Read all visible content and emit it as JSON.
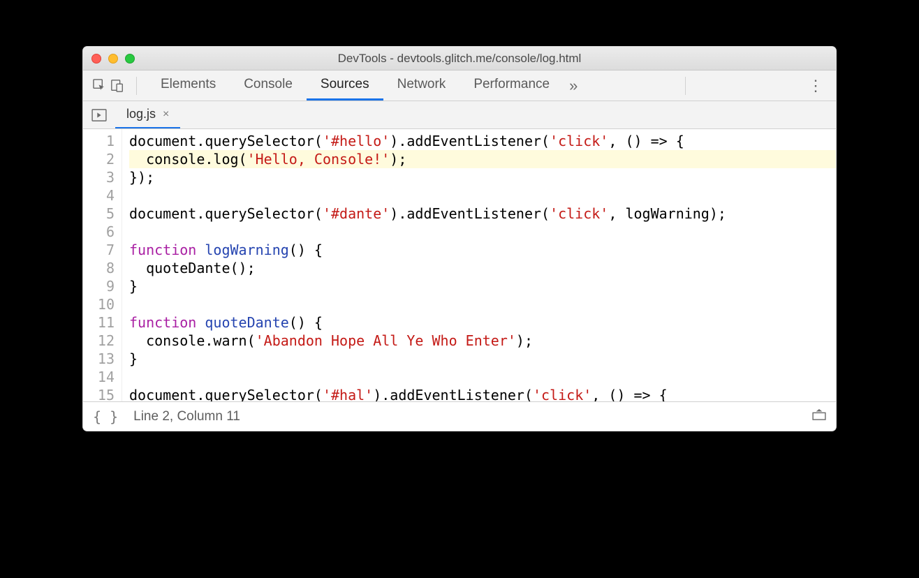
{
  "window": {
    "title": "DevTools - devtools.glitch.me/console/log.html"
  },
  "panels": {
    "elements": "Elements",
    "console": "Console",
    "sources": "Sources",
    "network": "Network",
    "performance": "Performance",
    "more": "»"
  },
  "fileTab": {
    "name": "log.js",
    "close": "×"
  },
  "status": {
    "braces": "{ }",
    "position": "Line 2, Column 11"
  },
  "code": {
    "lines": [
      {
        "n": "1",
        "hl": false,
        "tokens": [
          [
            "p",
            "document.querySelector("
          ],
          [
            "s",
            "'#hello'"
          ],
          [
            "p",
            ").addEventListener("
          ],
          [
            "s",
            "'click'"
          ],
          [
            "p",
            ", () => {"
          ]
        ]
      },
      {
        "n": "2",
        "hl": true,
        "tokens": [
          [
            "p",
            "  console.log("
          ],
          [
            "s",
            "'Hello, Console!'"
          ],
          [
            "p",
            ");"
          ]
        ]
      },
      {
        "n": "3",
        "hl": false,
        "tokens": [
          [
            "p",
            "});"
          ]
        ]
      },
      {
        "n": "4",
        "hl": false,
        "tokens": [
          [
            "p",
            ""
          ]
        ]
      },
      {
        "n": "5",
        "hl": false,
        "tokens": [
          [
            "p",
            "document.querySelector("
          ],
          [
            "s",
            "'#dante'"
          ],
          [
            "p",
            ").addEventListener("
          ],
          [
            "s",
            "'click'"
          ],
          [
            "p",
            ", logWarning);"
          ]
        ]
      },
      {
        "n": "6",
        "hl": false,
        "tokens": [
          [
            "p",
            ""
          ]
        ]
      },
      {
        "n": "7",
        "hl": false,
        "tokens": [
          [
            "k",
            "function"
          ],
          [
            "p",
            " "
          ],
          [
            "f",
            "logWarning"
          ],
          [
            "p",
            "() {"
          ]
        ]
      },
      {
        "n": "8",
        "hl": false,
        "tokens": [
          [
            "p",
            "  quoteDante();"
          ]
        ]
      },
      {
        "n": "9",
        "hl": false,
        "tokens": [
          [
            "p",
            "}"
          ]
        ]
      },
      {
        "n": "10",
        "hl": false,
        "tokens": [
          [
            "p",
            ""
          ]
        ]
      },
      {
        "n": "11",
        "hl": false,
        "tokens": [
          [
            "k",
            "function"
          ],
          [
            "p",
            " "
          ],
          [
            "f",
            "quoteDante"
          ],
          [
            "p",
            "() {"
          ]
        ]
      },
      {
        "n": "12",
        "hl": false,
        "tokens": [
          [
            "p",
            "  console.warn("
          ],
          [
            "s",
            "'Abandon Hope All Ye Who Enter'"
          ],
          [
            "p",
            ");"
          ]
        ]
      },
      {
        "n": "13",
        "hl": false,
        "tokens": [
          [
            "p",
            "}"
          ]
        ]
      },
      {
        "n": "14",
        "hl": false,
        "tokens": [
          [
            "p",
            ""
          ]
        ]
      },
      {
        "n": "15",
        "hl": false,
        "tokens": [
          [
            "p",
            "document.querySelector("
          ],
          [
            "s",
            "'#hal'"
          ],
          [
            "p",
            ").addEventListener("
          ],
          [
            "s",
            "'click'"
          ],
          [
            "p",
            ", () => {"
          ]
        ]
      }
    ]
  }
}
